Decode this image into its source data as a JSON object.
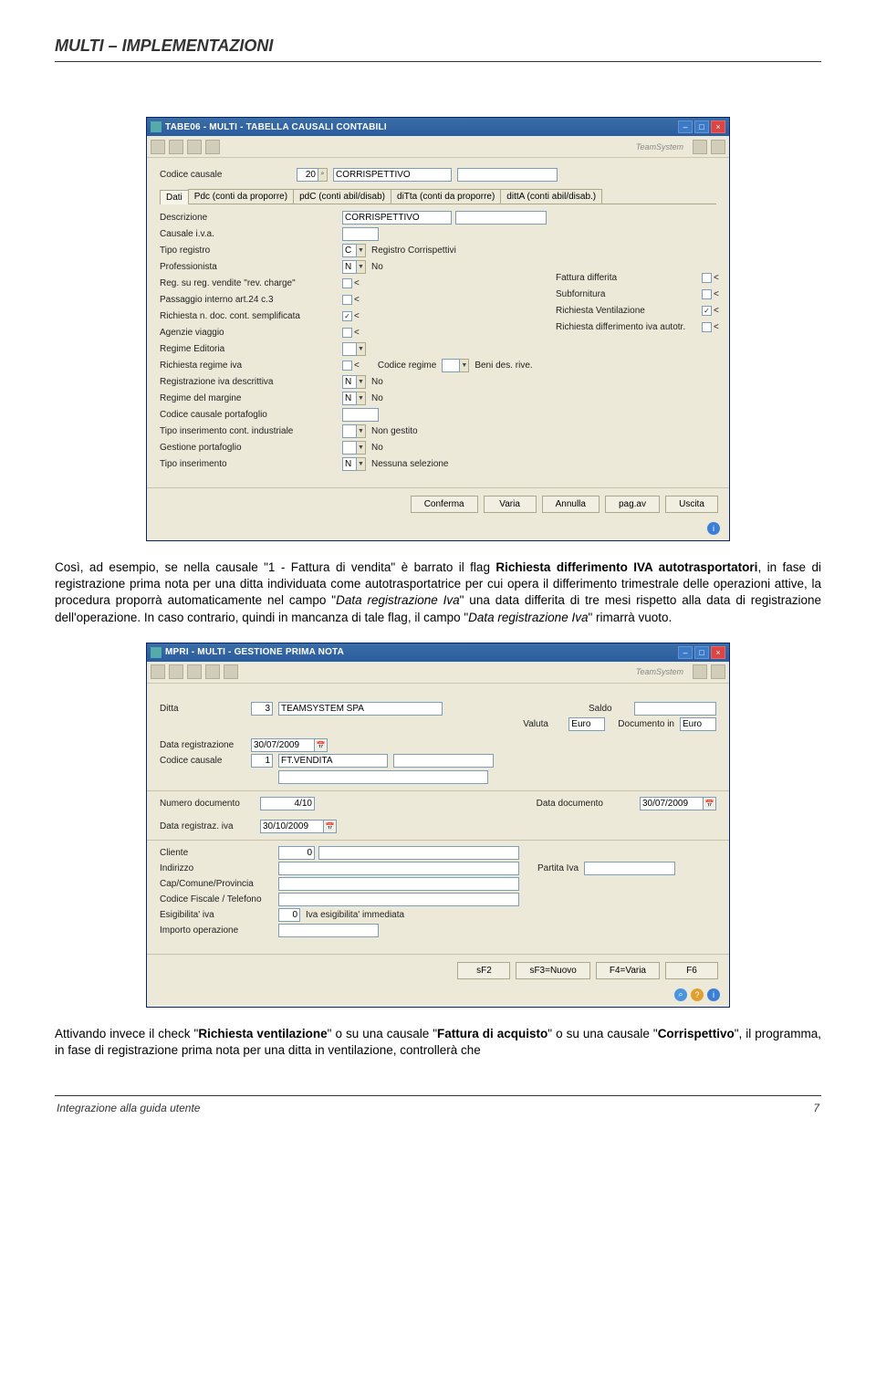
{
  "header": {
    "title": "MULTI – IMPLEMENTAZIONI"
  },
  "para1_before": "Così, ad esempio, se nella causale \"1 - Fattura di vendita\" è barrato il flag ",
  "para1_bold": "Richiesta differimento IVA autotrasportatori",
  "para1_after": ", in fase di registrazione prima nota per una ditta individuata come autotrasportatrice per cui opera il differimento trimestrale delle operazioni attive, la procedura proporrà automaticamente nel campo \"",
  "para1_ital1": "Data registrazione Iva",
  "para1_mid2": "\" una data differita di tre mesi rispetto alla data di registrazione dell'operazione. In caso contrario, quindi in mancanza di tale flag, il campo \"",
  "para1_ital2": "Data registrazione Iva",
  "para1_end": "\" rimarrà vuoto.",
  "para2_before": "Attivando invece il check \"",
  "para2_bold1": "Richiesta ventilazione",
  "para2_mid1": "\" o su una causale \"",
  "para2_bold2": "Fattura di acquisto",
  "para2_mid2": "\" o su una causale \"",
  "para2_bold3": "Corrispettivo",
  "para2_end": "\", il programma, in fase di registrazione prima nota per una ditta in ventilazione, controllerà che",
  "win1": {
    "title": "TABE06  -  MULTI  -  TABELLA CAUSALI CONTABILI",
    "brand": "TeamSystem",
    "codice_causale_lbl": "Codice causale",
    "codice_causale_val": "20",
    "codice_causale_desc": "CORRISPETTIVO",
    "tabs": [
      "Dati",
      "Pdc (conti da proporre)",
      "pdC (conti abil/disab)",
      "diTta (conti da proporre)",
      "dittA (conti abil/disab.)"
    ],
    "rows_left": [
      {
        "l": "Descrizione",
        "v": "CORRISPETTIVO"
      },
      {
        "l": "Causale i.v.a.",
        "v": ""
      },
      {
        "l": "Tipo registro",
        "v": "C",
        "d": "Registro Corrispettivi"
      },
      {
        "l": "Professionista",
        "v": "N",
        "d": "No"
      },
      {
        "l": "Reg. su reg. vendite \"rev. charge\"",
        "chk": false
      },
      {
        "l": "Passaggio interno art.24 c.3",
        "chk": false
      },
      {
        "l": "Richiesta n. doc. cont. semplificata",
        "chk": true
      },
      {
        "l": "Agenzie viaggio",
        "chk": false
      },
      {
        "l": "Regime Editoria",
        "v": ""
      },
      {
        "l": "Richiesta regime iva",
        "chk": false,
        "extra_l": "Codice regime",
        "extra_d": "Beni des. rive."
      },
      {
        "l": "Registrazione iva descrittiva",
        "v": "N",
        "d": "No"
      },
      {
        "l": "Regime del margine",
        "v": "N",
        "d": "No"
      },
      {
        "l": "Codice causale portafoglio",
        "v": ""
      },
      {
        "l": "Tipo inserimento cont. industriale",
        "v": "",
        "d": "Non gestito"
      },
      {
        "l": "Gestione portafoglio",
        "v": "",
        "d": "No"
      },
      {
        "l": "Tipo inserimento",
        "v": "N",
        "d": "Nessuna selezione"
      }
    ],
    "rows_right": [
      {
        "l": "Fattura differita",
        "chk": false
      },
      {
        "l": "Subfornitura",
        "chk": false
      },
      {
        "l": "Richiesta Ventilazione",
        "chk": true
      },
      {
        "l": "Richiesta differimento iva autotr.",
        "chk": false
      }
    ],
    "buttons": [
      "Conferma",
      "Varia",
      "Annulla",
      "pag.av",
      "Uscita"
    ]
  },
  "win2": {
    "title": "MPRI  -  MULTI  -  GESTIONE PRIMA NOTA",
    "brand": "TeamSystem",
    "ditta_lbl": "Ditta",
    "ditta_val": "3",
    "ditta_desc": "TEAMSYSTEM SPA",
    "saldo_lbl": "Saldo",
    "valuta_lbl": "Valuta",
    "valuta_val": "Euro",
    "docin_lbl": "Documento in",
    "docin_val": "Euro",
    "datareg_lbl": "Data registrazione",
    "datareg_val": "30/07/2009",
    "codcau_lbl": "Codice causale",
    "codcau_val": "1",
    "codcau_desc": "FT.VENDITA",
    "numdoc_lbl": "Numero documento",
    "numdoc_val": "4/10",
    "datadoc_lbl": "Data documento",
    "datadoc_val": "30/07/2009",
    "dataregiva_lbl": "Data registraz. iva",
    "dataregiva_val": "30/10/2009",
    "cliente_lbl": "Cliente",
    "cliente_val": "0",
    "indirizzo_lbl": "Indirizzo",
    "piva_lbl": "Partita Iva",
    "cap_lbl": "Cap/Comune/Provincia",
    "cf_lbl": "Codice Fiscale / Telefono",
    "esig_lbl": "Esigibilita' iva",
    "esig_val": "0",
    "esig_desc": "Iva esigibilita' immediata",
    "importo_lbl": "Importo operazione",
    "buttons": [
      "sF2",
      "sF3=Nuovo",
      "F4=Varia",
      "F6"
    ]
  },
  "footer": {
    "left": "Integrazione alla guida utente",
    "right": "7"
  }
}
